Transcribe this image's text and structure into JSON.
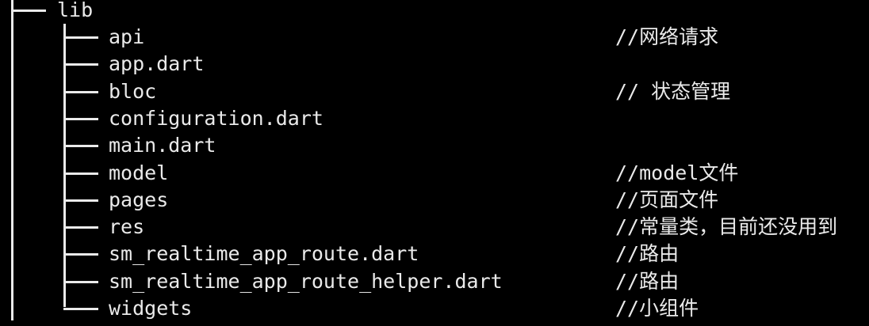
{
  "root": {
    "label": "lib"
  },
  "items": [
    {
      "name": "api",
      "comment": "//网络请求"
    },
    {
      "name": "app.dart",
      "comment": ""
    },
    {
      "name": "bloc",
      "comment": "// 状态管理"
    },
    {
      "name": "configuration.dart",
      "comment": ""
    },
    {
      "name": "main.dart",
      "comment": ""
    },
    {
      "name": "model",
      "comment": "//model文件"
    },
    {
      "name": "pages",
      "comment": "//页面文件"
    },
    {
      "name": "res",
      "comment": "//常量类，目前还没用到"
    },
    {
      "name": "sm_realtime_app_route.dart",
      "comment": "//路由"
    },
    {
      "name": "sm_realtime_app_route_helper.dart",
      "comment": "//路由"
    },
    {
      "name": "widgets",
      "comment": "//小组件"
    }
  ]
}
